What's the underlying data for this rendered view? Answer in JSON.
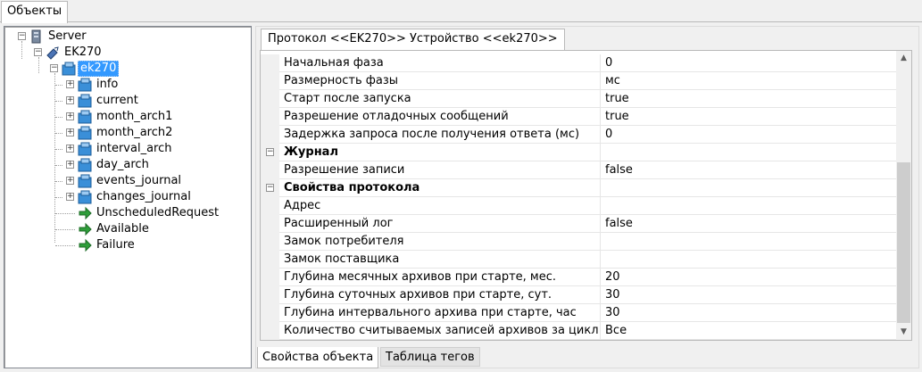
{
  "top_tab": {
    "label": "Объекты"
  },
  "tree": {
    "server": "Server",
    "ek270_device": "EK270",
    "ek270_selected": "ek270",
    "children": [
      "info",
      "current",
      "month_arch1",
      "month_arch2",
      "interval_arch",
      "day_arch",
      "events_journal",
      "changes_journal"
    ],
    "actions": [
      "UnscheduledRequest",
      "Available",
      "Failure"
    ]
  },
  "protocol_tab": {
    "label": "Протокол <<EK270>> Устройство <<ek270>>"
  },
  "grid": {
    "rows": [
      {
        "name": "Начальная фаза",
        "value": "0"
      },
      {
        "name": "Размерность фазы",
        "value": "мс"
      },
      {
        "name": "Старт после запуска",
        "value": "true"
      },
      {
        "name": "Разрешение отладочных сообщений",
        "value": "true"
      },
      {
        "name": "Задержка запроса после получения ответа (мс)",
        "value": "0"
      },
      {
        "category": "Журнал"
      },
      {
        "name": "Разрешение записи",
        "value": "false"
      },
      {
        "category": "Свойства протокола"
      },
      {
        "name": "Адрес",
        "value": ""
      },
      {
        "name": "Расширенный лог",
        "value": "false"
      },
      {
        "name": "Замок потребителя",
        "value": ""
      },
      {
        "name": "Замок поставщика",
        "value": ""
      },
      {
        "name": "Глубина месячных архивов при старте, мес.",
        "value": "20"
      },
      {
        "name": "Глубина суточных архивов при старте, сут.",
        "value": "30"
      },
      {
        "name": "Глубина интервального архива при старте, час",
        "value": "30"
      },
      {
        "name": "Количество считываемых записей архивов за цикл",
        "value": "Все"
      }
    ]
  },
  "bottom_tabs": {
    "active": "Свойства объекта",
    "inactive": "Таблица тегов"
  },
  "icons": {
    "server": "server-icon",
    "device": "device-link-icon",
    "object": "cube-folder-icon",
    "action": "green-arrow-icon"
  }
}
